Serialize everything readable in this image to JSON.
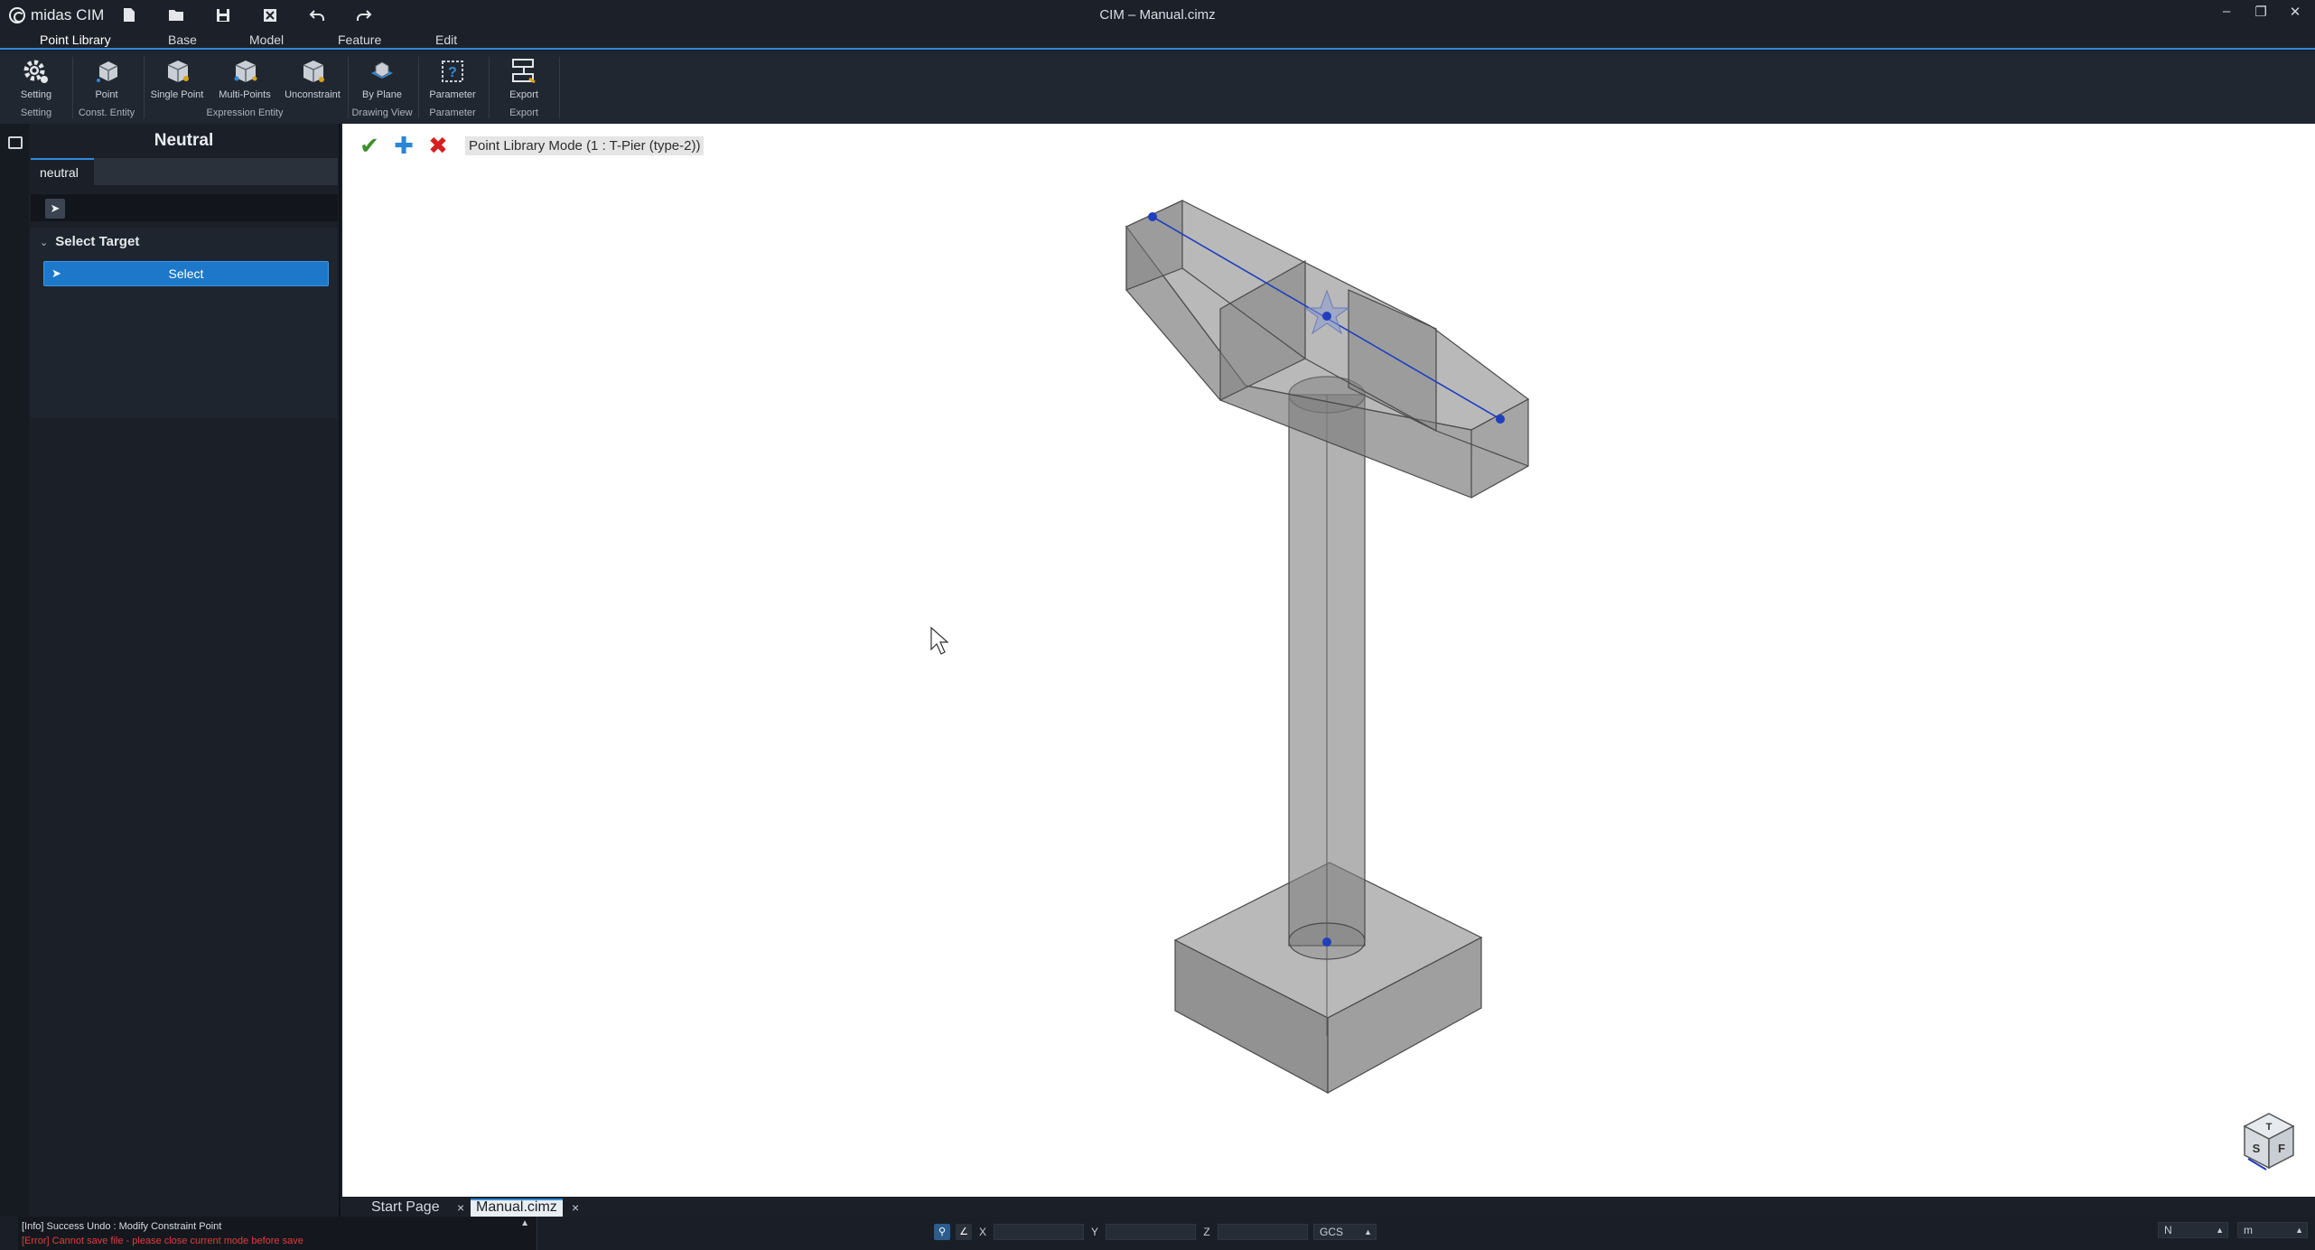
{
  "app": {
    "brand": "midas CIM",
    "window_title": "CIM – Manual.cimz",
    "quick_access": [
      {
        "icon": "new-file-icon"
      },
      {
        "icon": "open-folder-icon"
      },
      {
        "icon": "save-icon"
      },
      {
        "icon": "close-file-icon"
      },
      {
        "icon": "undo-icon"
      },
      {
        "icon": "redo-icon"
      }
    ],
    "window_controls": [
      "minimize-icon",
      "restore-icon",
      "close-icon"
    ]
  },
  "menu": {
    "tabs": [
      "Point Library",
      "Base",
      "Model",
      "Feature",
      "Edit"
    ],
    "active": "Point Library"
  },
  "ribbon": {
    "buttons": [
      {
        "label": "Setting",
        "icon": "gear-icon"
      },
      {
        "label": "Point",
        "icon": "point-box-icon"
      },
      {
        "label": "Single Point",
        "icon": "single-point-icon"
      },
      {
        "label": "Multi-Points",
        "icon": "multi-points-icon"
      },
      {
        "label": "Unconstraint",
        "icon": "unconstraint-icon"
      },
      {
        "label": "By Plane",
        "icon": "by-plane-icon"
      },
      {
        "label": "Parameter",
        "icon": "parameter-icon"
      },
      {
        "label": "Export",
        "icon": "export-icon"
      }
    ],
    "groups": [
      "Setting",
      "Const. Entity",
      "Expression Entity",
      "Drawing View",
      "Parameter",
      "Export"
    ]
  },
  "panel": {
    "title": "Neutral",
    "tab": "neutral",
    "section_title": "Select Target",
    "select_label": "Select"
  },
  "viewport": {
    "mode_label": "Point Library Mode (1 : T-Pier (type-2))",
    "tools": [
      {
        "icon": "confirm-check-icon",
        "color": "#3f8f2a"
      },
      {
        "icon": "add-plus-icon",
        "color": "#2a86d6"
      },
      {
        "icon": "cancel-x-icon",
        "color": "#d61f1f"
      }
    ],
    "view_cube_faces": [
      "T",
      "S",
      "F"
    ]
  },
  "doc_tabs": [
    {
      "label": "Start Page",
      "active": false
    },
    {
      "label": "Manual.cimz",
      "active": true
    }
  ],
  "status": {
    "info": "[Info] Success Undo : Modify Constraint Point",
    "error": "[Error] Cannot save file - please close current mode before save",
    "coords": {
      "x_label": "X",
      "y_label": "Y",
      "z_label": "Z",
      "cs": "GCS"
    },
    "unit_force": "N",
    "unit_length": "m"
  },
  "colors": {
    "accent": "#2f89d8",
    "select_button": "#1d78c9",
    "error_text": "#e03c3c",
    "model_fill": "#7f7f7f",
    "point_marker": "#1f3fbf"
  }
}
